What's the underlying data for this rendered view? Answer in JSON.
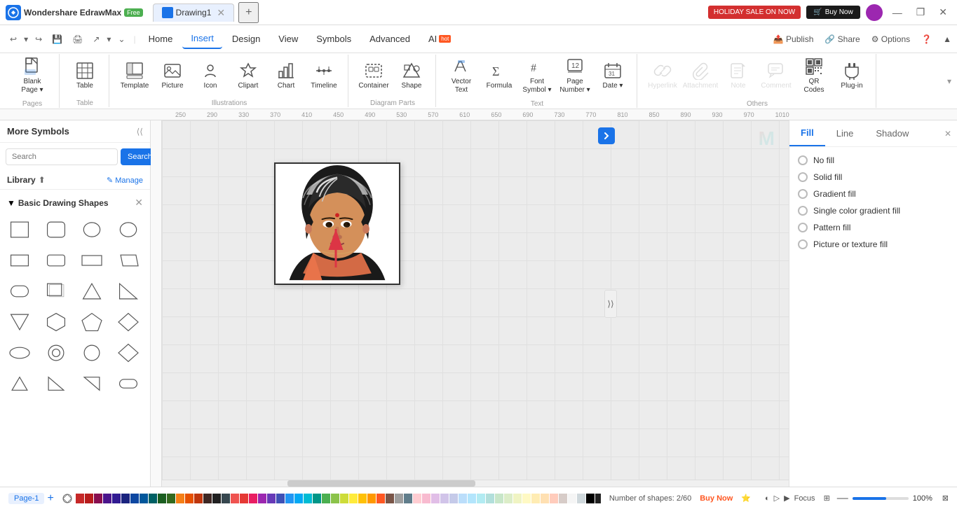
{
  "titlebar": {
    "app_name": "Wondershare EdrawMax",
    "free_label": "Free",
    "tab_name": "Drawing1",
    "holiday_label": "HOLIDAY SALE ON NOW",
    "buy_label": "Buy Now",
    "minimize": "—",
    "maximize": "❐",
    "close": "✕"
  },
  "menubar": {
    "items": [
      "Home",
      "Insert",
      "Design",
      "View",
      "Symbols",
      "Advanced",
      "AI"
    ],
    "active": "Insert",
    "ai_hot": "hot",
    "right": [
      "Publish",
      "Share",
      "Options",
      "?"
    ]
  },
  "toolbar": {
    "pages_group": {
      "label": "Pages",
      "blank_page": "Blank\nPage"
    },
    "table_group": {
      "label": "Table",
      "table": "Table"
    },
    "illustrations_group": {
      "label": "Illustrations",
      "items": [
        "Template",
        "Picture",
        "Icon",
        "Clipart",
        "Chart",
        "Timeline"
      ]
    },
    "diagram_parts_group": {
      "label": "Diagram Parts",
      "items": [
        "Container",
        "Shape"
      ]
    },
    "text_group": {
      "label": "Text",
      "items": [
        "Vector Text",
        "Formula",
        "Font Symbol",
        "Page Number",
        "Date"
      ]
    },
    "others_group": {
      "label": "Others",
      "items": [
        "Hyperlink",
        "Attachment",
        "Note",
        "Comment",
        "QR Codes",
        "Plug-in"
      ]
    }
  },
  "left_panel": {
    "title": "More Symbols",
    "search_placeholder": "Search",
    "search_btn": "Search",
    "library_label": "Library",
    "manage_label": "Manage",
    "shapes_section": {
      "title": "Basic Drawing Shapes",
      "shapes": [
        "rect",
        "rounded-rect",
        "circle",
        "circle2",
        "rect2",
        "rounded-rect2",
        "rect3",
        "parallelogram",
        "stadium",
        "rect-shadow",
        "triangle",
        "triangle2",
        "triangle3",
        "hexagon",
        "pentagon",
        "diamond",
        "ellipse",
        "donut",
        "circle3",
        "rhombus",
        "triangle4",
        "triangle5",
        "triangle6",
        "parallelogram2"
      ]
    }
  },
  "right_panel": {
    "fill_tab": "Fill",
    "line_tab": "Line",
    "shadow_tab": "Shadow",
    "fill_options": [
      {
        "label": "No fill",
        "selected": false
      },
      {
        "label": "Solid fill",
        "selected": false
      },
      {
        "label": "Gradient fill",
        "selected": false
      },
      {
        "label": "Single color gradient fill",
        "selected": false
      },
      {
        "label": "Pattern fill",
        "selected": false
      },
      {
        "label": "Picture or texture fill",
        "selected": false
      }
    ]
  },
  "canvas": {
    "watermark_text": "M"
  },
  "status_bar": {
    "page_name": "Page-1",
    "shapes_count": "Number of shapes: 2/60",
    "buy_now": "Buy Now",
    "zoom_level": "100%",
    "focus_label": "Focus"
  },
  "colors": [
    "#c62828",
    "#b71c1c",
    "#880e4f",
    "#4a148c",
    "#311b92",
    "#1a237e",
    "#0d47a1",
    "#01579b",
    "#006064",
    "#1b5e20",
    "#33691e",
    "#f57f17",
    "#e65100",
    "#bf360c",
    "#3e2723",
    "#212121",
    "#37474f",
    "#ef5350",
    "#e53935",
    "#e91e63",
    "#9c27b0",
    "#673ab7",
    "#3f51b5",
    "#2196f3",
    "#03a9f4",
    "#00bcd4",
    "#009688",
    "#4caf50",
    "#8bc34a",
    "#cddc39",
    "#ffeb3b",
    "#ffc107",
    "#ff9800",
    "#ff5722",
    "#795548",
    "#9e9e9e",
    "#607d8b",
    "#ffcdd2",
    "#f8bbd0",
    "#e1bee7",
    "#d1c4e9",
    "#c5cae9",
    "#bbdefb",
    "#b3e5fc",
    "#b2ebf2",
    "#b2dfdb",
    "#c8e6c9",
    "#dcedc8",
    "#f0f4c3",
    "#fff9c4",
    "#ffecb3",
    "#ffe0b2",
    "#ffccbc",
    "#d7ccc8",
    "#f5f5f5",
    "#cfd8dc",
    "#000000",
    "#212121",
    "#424242",
    "#616161",
    "#757575",
    "#9e9e9e",
    "#bdbdbd",
    "#e0e0e0",
    "#eeeeee",
    "#ffffff"
  ]
}
